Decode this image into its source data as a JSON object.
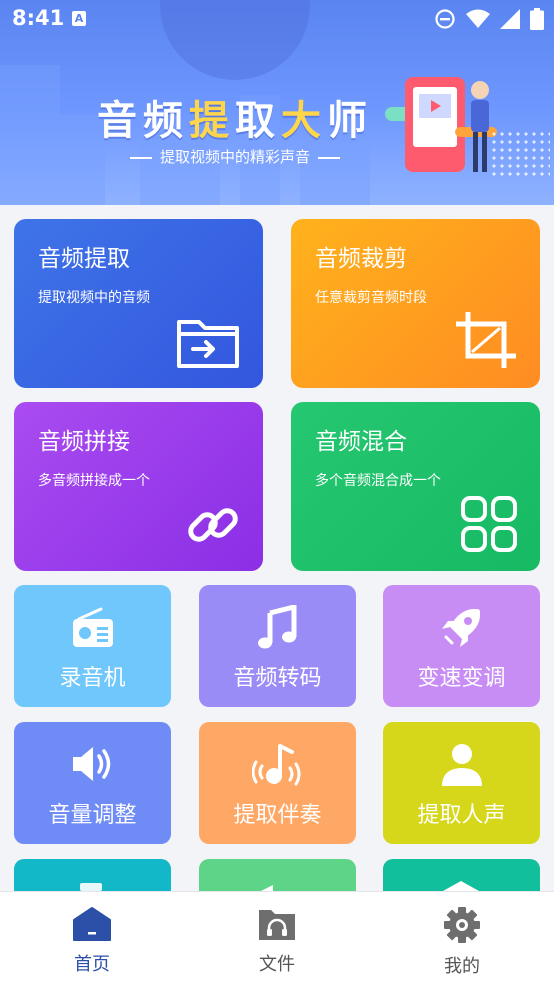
{
  "status": {
    "time": "8:41",
    "a_badge": "A"
  },
  "banner": {
    "title_part1": "音频",
    "title_hl1": "提",
    "title_part2": "取",
    "title_hl2": "大",
    "title_part3": "师",
    "subtitle": "提取视频中的精彩声音"
  },
  "features_big": [
    {
      "title": "音频提取",
      "desc": "提取视频中的音频",
      "icon": "folder-import-icon",
      "color": "#3f6be6"
    },
    {
      "title": "音频裁剪",
      "desc": "任意裁剪音频时段",
      "icon": "crop-icon",
      "color": "#ff9a1f"
    },
    {
      "title": "音频拼接",
      "desc": "多音频拼接成一个",
      "icon": "link-icon",
      "color": "#9b3ff0"
    },
    {
      "title": "音频混合",
      "desc": "多个音频混合成一个",
      "icon": "grid-icon",
      "color": "#21c46b"
    }
  ],
  "features_small": [
    {
      "label": "录音机",
      "icon": "radio-icon",
      "color": "#6fc7fb"
    },
    {
      "label": "音频转码",
      "icon": "music-note-icon",
      "color": "#9a8cf7"
    },
    {
      "label": "变速变调",
      "icon": "rocket-icon",
      "color": "#c88cf5"
    },
    {
      "label": "音量调整",
      "icon": "speaker-icon",
      "color": "#6f8cf6"
    },
    {
      "label": "提取伴奏",
      "icon": "music-waves-icon",
      "color": "#ffa866"
    },
    {
      "label": "提取人声",
      "icon": "person-icon",
      "color": "#d6d61a"
    }
  ],
  "nav": [
    {
      "label": "首页",
      "icon": "home-icon",
      "active": true
    },
    {
      "label": "文件",
      "icon": "folder-headphones-icon",
      "active": false
    },
    {
      "label": "我的",
      "icon": "gear-icon",
      "active": false
    }
  ]
}
